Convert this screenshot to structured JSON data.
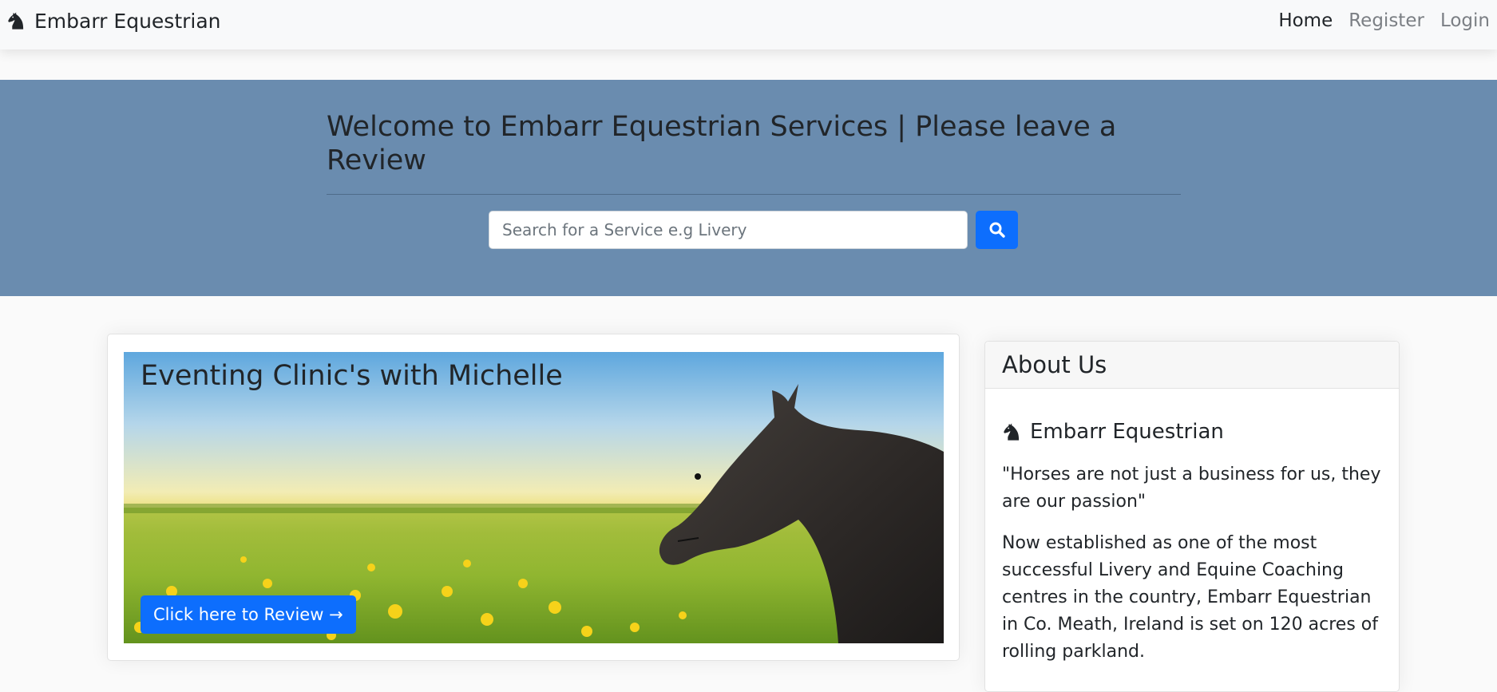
{
  "navbar": {
    "brand": "Embarr Equestrian",
    "brand_icon": "horse-chess-knight-icon",
    "links": [
      {
        "label": "Home",
        "active": true
      },
      {
        "label": "Register",
        "active": false
      },
      {
        "label": "Login",
        "active": false
      }
    ]
  },
  "hero": {
    "title": "Welcome to Embarr Equestrian Services | Please leave a Review",
    "background_color": "#6a8caf",
    "search": {
      "placeholder": "Search for a Service e.g Livery",
      "value": "",
      "button_icon": "search-icon"
    }
  },
  "feature": {
    "title": "Eventing Clinic's with Michelle",
    "button_label": "Click here to Review →"
  },
  "about": {
    "header": "About Us",
    "brand": "Embarr Equestrian",
    "quote": "\"Horses are not just a business for us, they are our passion\"",
    "body": "Now established as one of the most successful Livery and Equine Coaching centres in the country, Embarr Equestrian in Co. Meath, Ireland is set on 120 acres of rolling parkland."
  },
  "colors": {
    "primary": "#0d6efd",
    "hero_bg": "#6a8caf",
    "navbar_bg": "#f8f9fa"
  }
}
